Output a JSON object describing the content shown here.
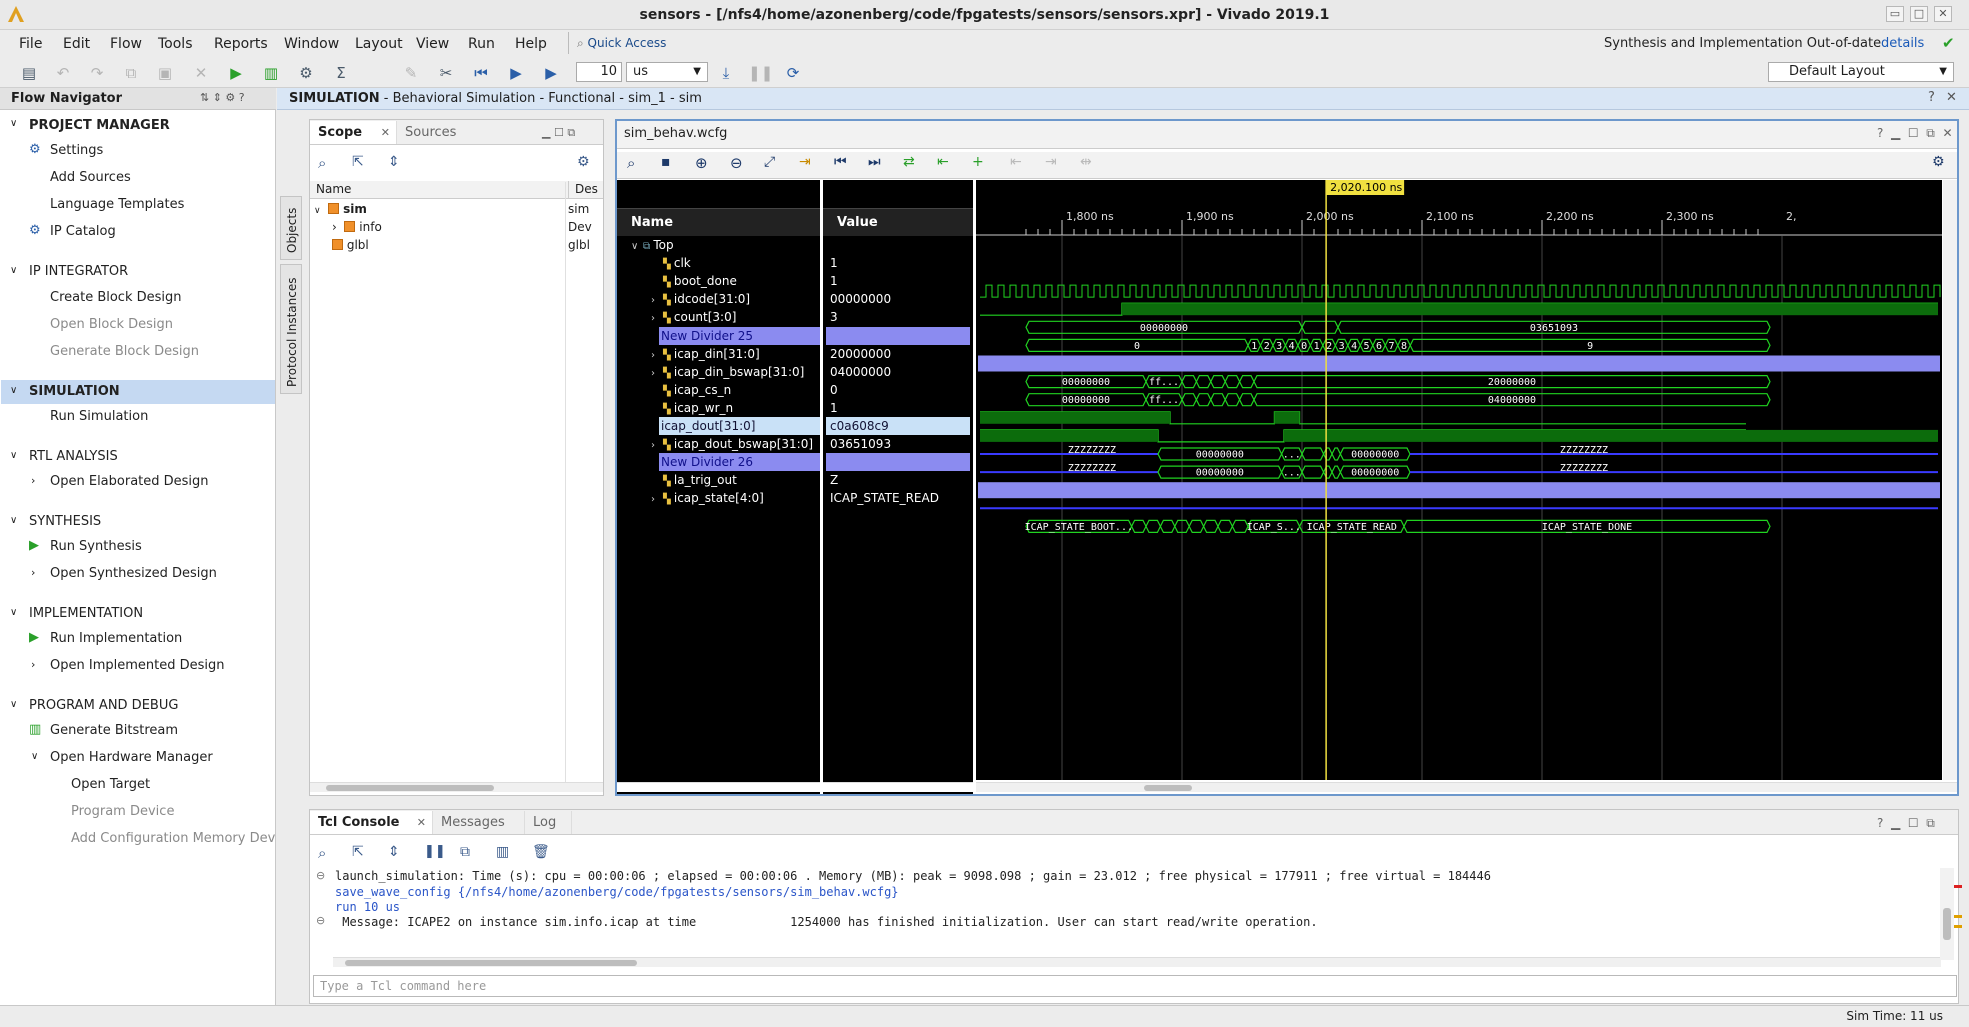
{
  "window": {
    "title": "sensors - [/nfs4/home/azonenberg/code/fpgatests/sensors/sensors.xpr] - Vivado 2019.1",
    "controls": [
      "▭",
      "□",
      "✕"
    ]
  },
  "menu": [
    "File",
    "Edit",
    "Flow",
    "Tools",
    "Reports",
    "Window",
    "Layout",
    "View",
    "Run",
    "Help"
  ],
  "quick_access": "Quick Access",
  "top_status": {
    "text": "Synthesis and Implementation Out-of-date",
    "link": "details"
  },
  "toolbar": {
    "run_time_value": "10",
    "run_time_unit": "us",
    "layout": "Default Layout"
  },
  "flow_navigator": {
    "title": "Flow Navigator",
    "sections": [
      {
        "label": "PROJECT MANAGER",
        "items": [
          "Settings",
          "Add Sources",
          "Language Templates",
          "IP Catalog"
        ]
      },
      {
        "label": "IP INTEGRATOR",
        "items": [
          "Create Block Design",
          "Open Block Design",
          "Generate Block Design"
        ]
      },
      {
        "label": "SIMULATION",
        "items": [
          "Run Simulation"
        ]
      },
      {
        "label": "RTL ANALYSIS",
        "items": [
          "Open Elaborated Design"
        ]
      },
      {
        "label": "SYNTHESIS",
        "items": [
          "Run Synthesis",
          "Open Synthesized Design"
        ]
      },
      {
        "label": "IMPLEMENTATION",
        "items": [
          "Run Implementation",
          "Open Implemented Design"
        ]
      },
      {
        "label": "PROGRAM AND DEBUG",
        "items": [
          "Generate Bitstream",
          "Open Hardware Manager",
          "Open Target",
          "Program Device",
          "Add Configuration Memory Device"
        ]
      }
    ]
  },
  "sim_header": {
    "title": "SIMULATION",
    "subtitle": " - Behavioral Simulation - Functional - sim_1 - sim"
  },
  "side_tabs": [
    "Objects",
    "Protocol Instances"
  ],
  "scope": {
    "tabs": [
      "Scope",
      "Sources"
    ],
    "columns": [
      "Name",
      "Des"
    ],
    "rows": [
      {
        "name": "sim",
        "desc": "sim"
      },
      {
        "name": "info",
        "desc": "Dev"
      },
      {
        "name": "glbl",
        "desc": "glbl"
      }
    ]
  },
  "wave": {
    "tab": "sim_behav.wcfg",
    "name_header": "Name",
    "value_header": "Value",
    "cursor_label": "2,020.100 ns",
    "time_ticks": [
      "1,800 ns",
      "1,900 ns",
      "2,000 ns",
      "2,100 ns",
      "2,200 ns",
      "2,300 ns",
      "2,"
    ],
    "signals": [
      {
        "name": "Top",
        "value": ""
      },
      {
        "name": "clk",
        "value": "1"
      },
      {
        "name": "boot_done",
        "value": "1"
      },
      {
        "name": "idcode[31:0]",
        "value": "00000000"
      },
      {
        "name": "count[3:0]",
        "value": "3"
      },
      {
        "name": "New Divider 25",
        "value": ""
      },
      {
        "name": "icap_din[31:0]",
        "value": "20000000"
      },
      {
        "name": "icap_din_bswap[31:0]",
        "value": "04000000"
      },
      {
        "name": "icap_cs_n",
        "value": "0"
      },
      {
        "name": "icap_wr_n",
        "value": "1"
      },
      {
        "name": "icap_dout[31:0]",
        "value": "c0a608c9"
      },
      {
        "name": "icap_dout_bswap[31:0]",
        "value": "03651093"
      },
      {
        "name": "New Divider 26",
        "value": ""
      },
      {
        "name": "la_trig_out",
        "value": "Z"
      },
      {
        "name": "icap_state[4:0]",
        "value": "ICAP_STATE_READ"
      }
    ],
    "bus_labels": {
      "idcode_a": "00000000",
      "idcode_b": "03651093",
      "count_a": "0",
      "count_digits": [
        "1",
        "2",
        "3",
        "4",
        "0",
        "1",
        "2",
        "3",
        "4",
        "5",
        "6",
        "7",
        "8"
      ],
      "count_b": "9",
      "din_a": "00000000",
      "din_ff": "ff...",
      "din_b": "20000000",
      "dinb_a": "00000000",
      "dinb_ff": "ff...",
      "dinb_b": "04000000",
      "dout_z1": "ZZZZZZZZ",
      "dout_mid": "00000000",
      "dout_dots": "...",
      "dout_mid2": "00000000",
      "dout_z2": "ZZZZZZZZ",
      "doutb_z1": "ZZZZZZZZ",
      "doutb_mid": "00000000",
      "doutb_dots": "...",
      "doutb_mid2": "00000000",
      "doutb_z2": "ZZZZZZZZ",
      "st_boot": "ICAP_STATE_BOOT...",
      "st_s": "ICAP_S...",
      "st_read": "ICAP_STATE_READ",
      "st_done": "ICAP_STATE_DONE"
    }
  },
  "console": {
    "tabs": [
      "Tcl Console",
      "Messages",
      "Log"
    ],
    "lines": [
      {
        "text": "launch_simulation: Time (s): cpu = 00:00:06 ; elapsed = 00:00:06 . Memory (MB): peak = 9098.098 ; gain = 23.012 ; free physical = 177911 ; free virtual = 184446",
        "color": "#222222"
      },
      {
        "text": "save_wave_config {/nfs4/home/azonenberg/code/fpgatests/sensors/sim_behav.wcfg}",
        "color": "#2a55c8"
      },
      {
        "text": "run 10 us",
        "color": "#2a55c8"
      },
      {
        "text": " Message: ICAPE2 on instance sim.info.icap at time             1254000 has finished initialization. User can start read/write operation.",
        "color": "#222222"
      }
    ],
    "placeholder": "Type a Tcl command here"
  },
  "status_bar": {
    "sim_time": "Sim Time: 11 us"
  },
  "colors": {
    "wave_green": "#21d321",
    "cursor": "#f0e040",
    "divider": "#8b8bf0",
    "selection": "#c5d9f2"
  }
}
